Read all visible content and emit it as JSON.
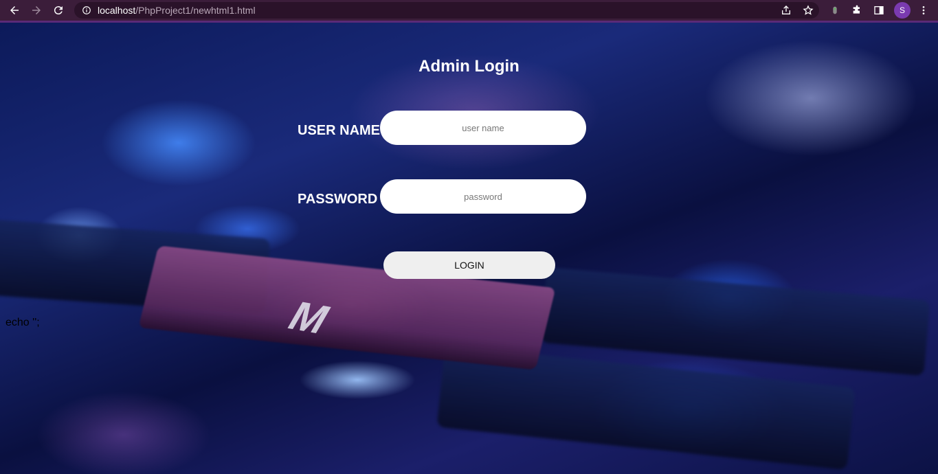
{
  "browser": {
    "url_host": "localhost",
    "url_path": "/PhpProject1/newhtml1.html",
    "profile_initial": "S",
    "icons": [
      "back-icon",
      "forward-icon",
      "reload-icon",
      "info-icon",
      "share-icon",
      "star-icon",
      "extension-icon",
      "puzzle-icon",
      "side-panel-icon",
      "menu-icon"
    ]
  },
  "login": {
    "title": "Admin Login",
    "username_label": "USER NAME",
    "username_placeholder": "user name",
    "password_label": "PASSWORD",
    "password_placeholder": "password",
    "button_label": "LOGIN"
  },
  "page": {
    "echo_text": "echo '';"
  },
  "colors": {
    "browser_bar": "#3b1d3a",
    "accent_border": "#5a2a78",
    "label_text": "#ffffff",
    "button_bg": "#efefef"
  }
}
